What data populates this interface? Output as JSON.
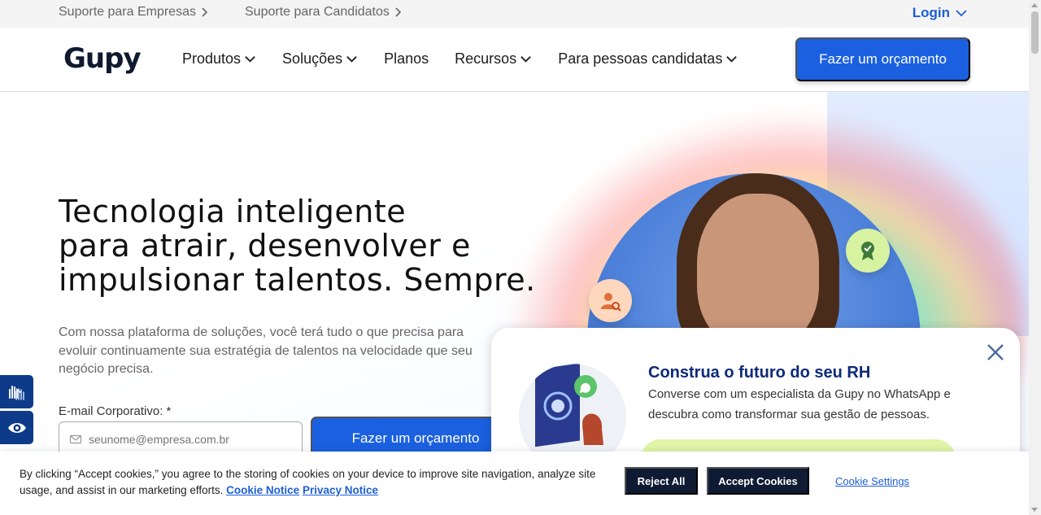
{
  "topbar": {
    "links": [
      "Suporte para Empresas",
      "Suporte para Candidatos"
    ],
    "login_label": "Login"
  },
  "header": {
    "logo_text": "Gupy",
    "nav": [
      {
        "label": "Produtos",
        "dropdown": true
      },
      {
        "label": "Soluções",
        "dropdown": true
      },
      {
        "label": "Planos",
        "dropdown": false
      },
      {
        "label": "Recursos",
        "dropdown": true
      },
      {
        "label": "Para pessoas candidatas",
        "dropdown": true
      }
    ],
    "cta_label": "Fazer um orçamento"
  },
  "hero": {
    "title_lines": [
      "Tecnologia inteligente",
      "para atrair, desenvolver e",
      "impulsionar talentos. Sempre."
    ],
    "subtitle": "Com nossa plataforma de soluções, você terá tudo o que precisa para evoluir continuamente sua estratégia de talentos na velocidade que seu negócio precisa.",
    "email_label": "E-mail Corporativo: *",
    "email_placeholder": "seunome@empresa.com.br",
    "cta_label": "Fazer um orçamento"
  },
  "popup": {
    "title": "Construa o futuro do seu RH",
    "text": "Converse com um especialista da Gupy no WhatsApp e descubra como transformar sua gestão de pessoas."
  },
  "cookie": {
    "text": "By clicking “Accept cookies,” you agree to the storing of cookies on your device to improve site navigation, analyze site usage, and assist in our marketing efforts.",
    "link_notice": "Cookie Notice",
    "link_privacy": "Privacy Notice",
    "reject_label": "Reject All",
    "accept_label": "Accept Cookies",
    "settings_label": "Cookie Settings"
  },
  "colors": {
    "brand_blue": "#1b60e0",
    "dark_navy": "#0f1a33",
    "popup_title": "#0d2a7a"
  }
}
